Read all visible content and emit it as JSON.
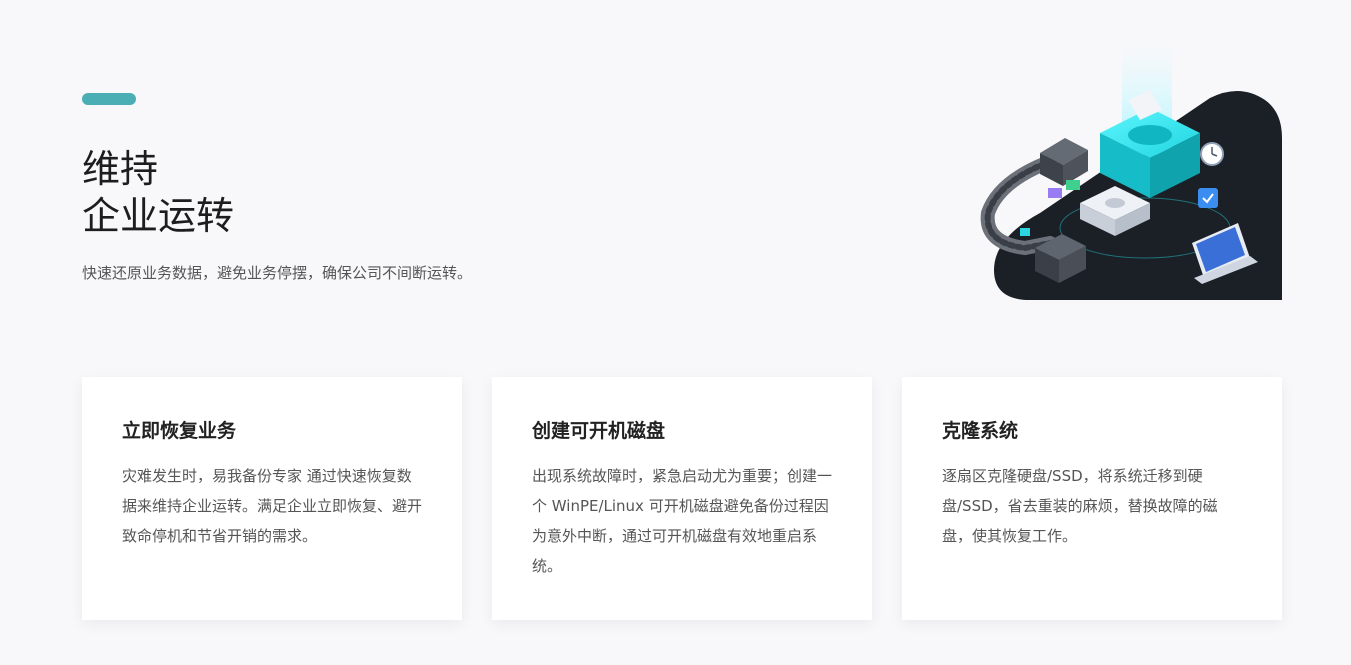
{
  "hero": {
    "title_line1": "维持",
    "title_line2": "企业运转",
    "subtitle": "快速还原业务数据，避免业务停摆，确保公司不间断运转。",
    "accent_color": "#4aaeb4",
    "illustration_icon": "server-gear-isometric-illustration"
  },
  "cards": [
    {
      "title": "立即恢复业务",
      "text": "灾难发生时，易我备份专家 通过快速恢复数据来维持企业运转。满足企业立即恢复、避开致命停机和节省开销的需求。"
    },
    {
      "title": "创建可开机磁盘",
      "text": "出现系统故障时，紧急启动尤为重要；创建一个 WinPE/Linux 可开机磁盘避免备份过程因为意外中断，通过可开机磁盘有效地重启系统。"
    },
    {
      "title": "克隆系统",
      "text": "逐扇区克隆硬盘/SSD，将系统迁移到硬盘/SSD，省去重装的麻烦，替换故障的磁盘，使其恢复工作。"
    }
  ]
}
